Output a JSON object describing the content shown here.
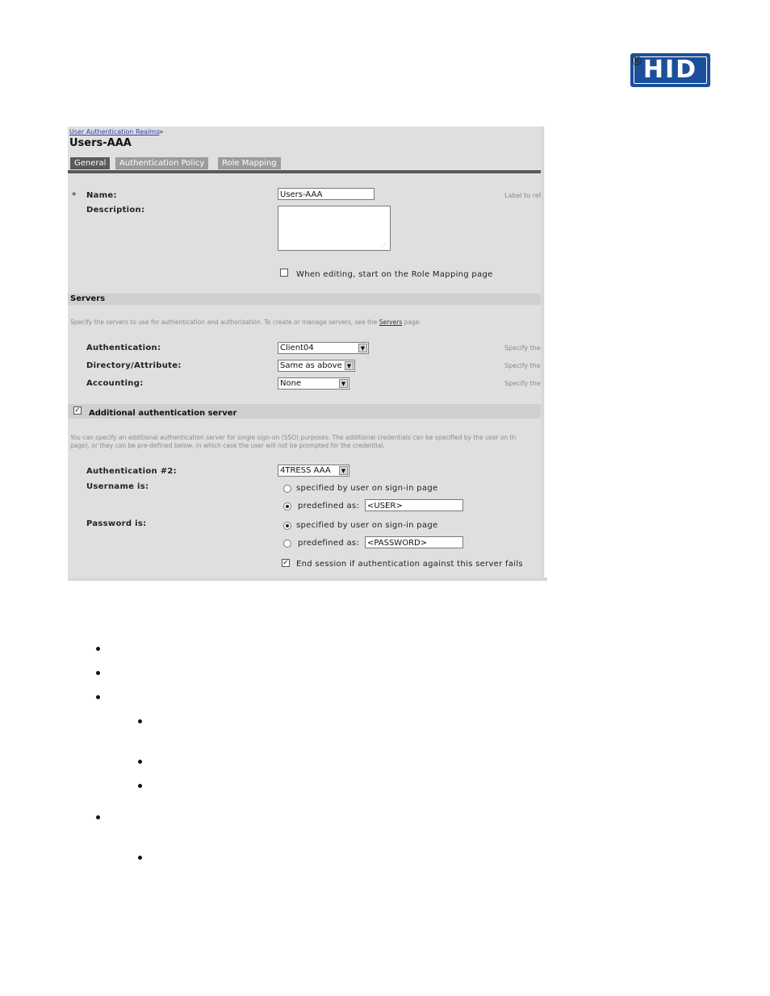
{
  "brand": {
    "logo_text": "HID",
    "registered_mark": "®"
  },
  "breadcrumb": {
    "link": "User Authentication Realms",
    "separator": ">"
  },
  "page_title": "Users-AAA",
  "tabs": [
    {
      "label": "General",
      "active": true
    },
    {
      "label": "Authentication Policy",
      "active": false
    },
    {
      "label": "Role Mapping",
      "active": false
    }
  ],
  "general": {
    "required_mark": "*",
    "name_label": "Name:",
    "name_value": "Users-AAA",
    "name_hint": "Label to ref",
    "description_label": "Description:",
    "description_value": "",
    "role_mapping_checkbox_label": "When editing, start on the Role Mapping page",
    "role_mapping_checked": false
  },
  "servers": {
    "section_title": "Servers",
    "description": "Specify the servers to use for authentication and authorization. To create or manage servers, see the",
    "description_link": "Servers",
    "description_suffix": "page.",
    "authentication_label": "Authentication:",
    "authentication_value": "Client04",
    "authentication_hint": "Specify the",
    "directory_label": "Directory/Attribute:",
    "directory_value": "Same as above",
    "directory_hint": "Specify the",
    "accounting_label": "Accounting:",
    "accounting_value": "None",
    "accounting_hint": "Specify the"
  },
  "additional": {
    "section_title": "Additional authentication server",
    "checked": true,
    "description_line1": "You can specify an additional authentication server for single sign-on (SSO) purposes. The additional credentials can be specified by the user on th",
    "description_line2": "page), or they can be pre-defined below, in which case the user will not be prompted for the credential.",
    "auth2_label": "Authentication #2:",
    "auth2_value": "4TRESS AAA",
    "username_label": "Username is:",
    "username_option1": "specified by user on sign-in page",
    "username_option2": "predefined as:",
    "username_value": "<USER>",
    "username_selected": "predefined",
    "password_label": "Password is:",
    "password_option1": "specified by user on sign-in page",
    "password_option2": "predefined as:",
    "password_value": "<PASSWORD>",
    "password_selected": "specified",
    "end_session_label": "End session if authentication against this server fails",
    "end_session_checked": true
  },
  "colors": {
    "brand_blue": "#1b4f9c",
    "tab_active": "#5a5a5a",
    "tab_inactive": "#9c9c9c",
    "panel_bg": "#dfdfdf"
  }
}
